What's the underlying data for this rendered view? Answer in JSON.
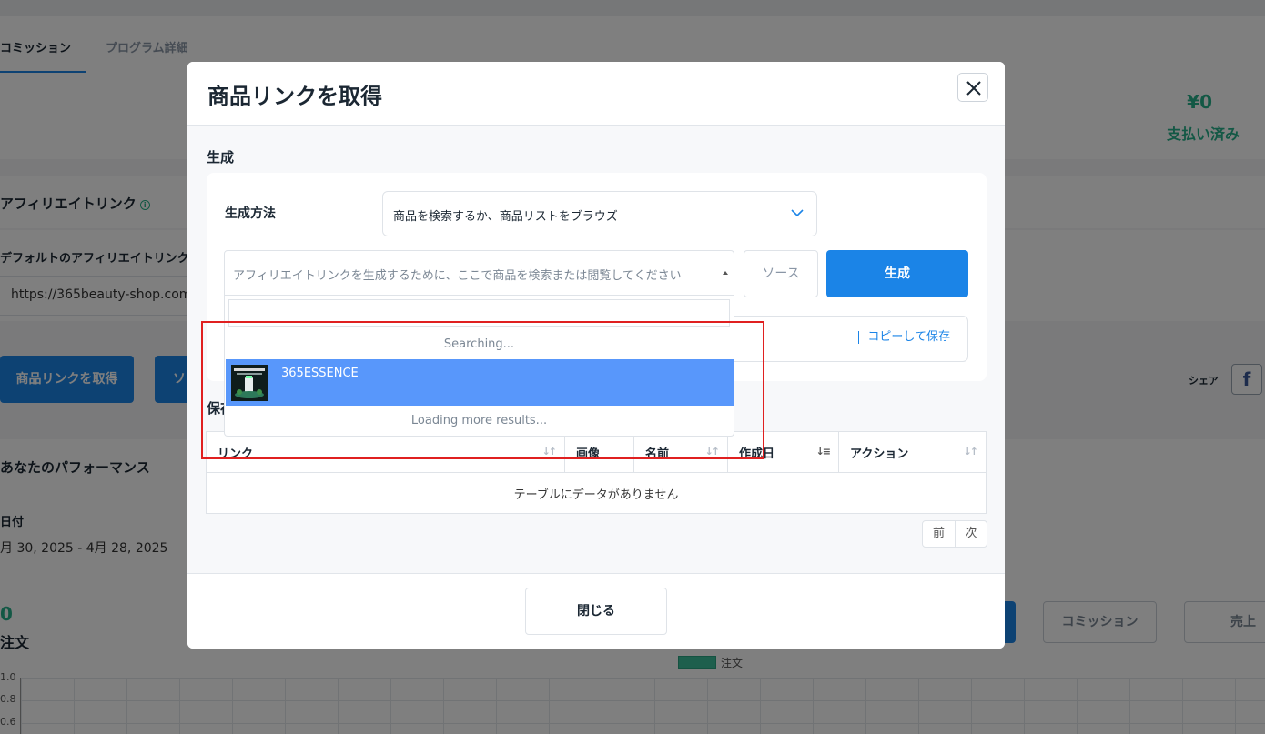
{
  "background": {
    "tabs": [
      {
        "label": "コミッション"
      },
      {
        "label": "プログラム詳細"
      }
    ],
    "summary": {
      "amount": "¥0",
      "amount_label": "支払い済み"
    },
    "affiliate": {
      "title": "アフィリエイトリンク",
      "default_label": "デフォルトのアフィリエイトリンク",
      "url": "https://365beauty-shop.com"
    },
    "buttons": {
      "get_product_link": "商品リンクを取得",
      "source_partial": "ソ"
    },
    "share": {
      "label": "シェア",
      "facebook": "f"
    },
    "performance": {
      "title": "あなたのパフォーマンス",
      "date_label": "日付",
      "date_range": "月 30, 2025 - 4月 28, 2025",
      "value": "0",
      "metric": "注文",
      "toggle_commission": "コミッション",
      "toggle_sales": "売上",
      "legend": "注文",
      "yticks": [
        "1.0",
        "0.8",
        "0.6"
      ]
    }
  },
  "modal": {
    "title": "商品リンクを取得",
    "section_label": "生成",
    "method_label": "生成方法",
    "method_value": "商品を検索するか、商品リストをブラウズ",
    "search_placeholder": "アフィリエイトリンクを生成するために、ここで商品を検索または閲覧してください",
    "source_button": "ソース",
    "generate_button": "生成",
    "copy_save": "コピーして保存",
    "saved_label": "保存",
    "table": {
      "columns": [
        "リンク",
        "画像",
        "名前",
        "作成日",
        "アクション"
      ],
      "empty_message": "テーブルにデータがありません"
    },
    "pager": {
      "prev": "前",
      "next": "次"
    },
    "close_button": "閉じる"
  },
  "dropdown": {
    "searching": "Searching...",
    "option": "365ESSENCE",
    "loading": "Loading more results..."
  },
  "colors": {
    "primary": "#1b84e7",
    "accent_green": "#27b08a",
    "option_highlight": "#5897fb",
    "annotation": "#e02020"
  }
}
